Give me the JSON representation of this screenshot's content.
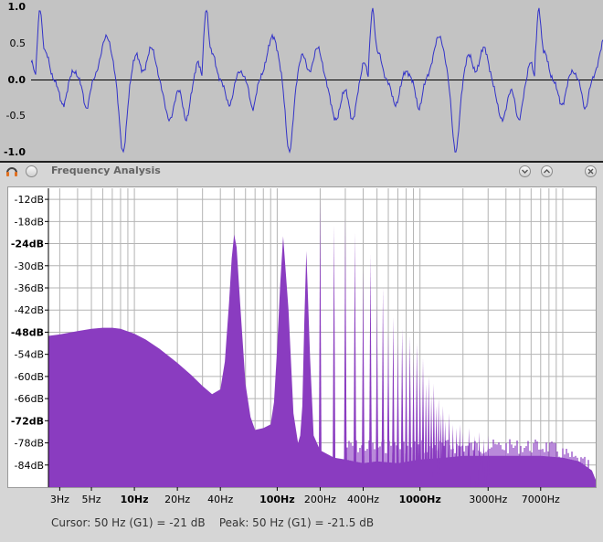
{
  "waveform": {
    "y_labels": [
      "1.0",
      "0.5",
      "0.0",
      "-0.5",
      "-1.0"
    ],
    "y_values": [
      1.0,
      0.5,
      0.0,
      -0.5,
      -1.0
    ],
    "bold_labels": [
      "1.0",
      "0.0",
      "-1.0"
    ],
    "line_color": "#3232c8",
    "zero_line_color": "#000000"
  },
  "window": {
    "title": "Frequency Analysis",
    "buttons": [
      "audio-icon",
      "menu-icon",
      "minimize-icon",
      "maximize-icon",
      "close-icon"
    ]
  },
  "chart_data": {
    "type": "area",
    "title": "",
    "xlabel": "",
    "ylabel": "",
    "x_scale": "log",
    "x_ticks": [
      {
        "label": "3Hz",
        "value": 3,
        "bold": false
      },
      {
        "label": "5Hz",
        "value": 5,
        "bold": false
      },
      {
        "label": "10Hz",
        "value": 10,
        "bold": true
      },
      {
        "label": "20Hz",
        "value": 20,
        "bold": false
      },
      {
        "label": "40Hz",
        "value": 40,
        "bold": false
      },
      {
        "label": "100Hz",
        "value": 100,
        "bold": true
      },
      {
        "label": "200Hz",
        "value": 200,
        "bold": false
      },
      {
        "label": "400Hz",
        "value": 400,
        "bold": false
      },
      {
        "label": "1000Hz",
        "value": 1000,
        "bold": true
      },
      {
        "label": "3000Hz",
        "value": 3000,
        "bold": false
      },
      {
        "label": "7000Hz",
        "value": 7000,
        "bold": false
      }
    ],
    "y_ticks": [
      {
        "label": "-12dB",
        "value": -12,
        "bold": false
      },
      {
        "label": "-18dB",
        "value": -18,
        "bold": false
      },
      {
        "label": "-24dB",
        "value": -24,
        "bold": true
      },
      {
        "label": "-30dB",
        "value": -30,
        "bold": false
      },
      {
        "label": "-36dB",
        "value": -36,
        "bold": false
      },
      {
        "label": "-42dB",
        "value": -42,
        "bold": false
      },
      {
        "label": "-48dB",
        "value": -48,
        "bold": true
      },
      {
        "label": "-54dB",
        "value": -54,
        "bold": false
      },
      {
        "label": "-60dB",
        "value": -60,
        "bold": false
      },
      {
        "label": "-66dB",
        "value": -66,
        "bold": false
      },
      {
        "label": "-72dB",
        "value": -72,
        "bold": true
      },
      {
        "label": "-78dB",
        "value": -78,
        "bold": false
      },
      {
        "label": "-84dB",
        "value": -84,
        "bold": false
      }
    ],
    "xlim": [
      2.5,
      17000
    ],
    "ylim": [
      -90,
      -9
    ],
    "grid": true,
    "fill_color": "#8a3cc0",
    "spectrum": {
      "x": [
        2.5,
        3,
        4,
        5,
        6,
        7,
        8,
        10,
        12,
        15,
        20,
        25,
        30,
        35,
        40,
        43,
        46,
        48,
        50,
        52,
        55,
        60,
        65,
        70,
        80,
        90,
        95,
        100,
        105,
        110,
        120,
        130,
        140,
        145,
        150,
        155,
        160,
        170,
        180,
        200,
        250,
        300,
        400,
        500,
        700,
        1000,
        1500,
        2000,
        3000,
        5000,
        7000,
        10000,
        13000,
        16000,
        17000
      ],
      "y": [
        -49,
        -48.6,
        -47.7,
        -47.1,
        -46.8,
        -46.8,
        -47.1,
        -48.4,
        -50,
        -52.5,
        -56.3,
        -59.6,
        -62.6,
        -64.8,
        -63.5,
        -56,
        -40,
        -28,
        -21.5,
        -25,
        -40,
        -62,
        -71,
        -74.5,
        -74,
        -73,
        -67,
        -52,
        -35,
        -22,
        -42,
        -70,
        -78,
        -76,
        -68,
        -45,
        -26,
        -55,
        -76,
        -80,
        -82,
        -82.5,
        -83.5,
        -83,
        -83.5,
        -82.5,
        -82,
        -81.5,
        -81.5,
        -81.5,
        -81.5,
        -82,
        -83,
        -85.5,
        -88
      ]
    },
    "harmonic_spikes": [
      {
        "f": 200,
        "db": -12
      },
      {
        "f": 250,
        "db": -19
      },
      {
        "f": 300,
        "db": -17
      },
      {
        "f": 350,
        "db": -21
      },
      {
        "f": 400,
        "db": -31
      },
      {
        "f": 450,
        "db": -27
      },
      {
        "f": 500,
        "db": -40
      },
      {
        "f": 550,
        "db": -36
      },
      {
        "f": 600,
        "db": -48
      },
      {
        "f": 650,
        "db": -44
      },
      {
        "f": 700,
        "db": -51
      },
      {
        "f": 750,
        "db": -47
      },
      {
        "f": 800,
        "db": -52
      },
      {
        "f": 850,
        "db": -49
      },
      {
        "f": 900,
        "db": -55
      },
      {
        "f": 950,
        "db": -51
      },
      {
        "f": 1000,
        "db": -58
      },
      {
        "f": 1050,
        "db": -55
      },
      {
        "f": 1100,
        "db": -62
      },
      {
        "f": 1150,
        "db": -60
      },
      {
        "f": 1200,
        "db": -65
      },
      {
        "f": 1250,
        "db": -62
      },
      {
        "f": 1300,
        "db": -68
      },
      {
        "f": 1350,
        "db": -66
      },
      {
        "f": 1400,
        "db": -70
      },
      {
        "f": 1450,
        "db": -68
      },
      {
        "f": 1500,
        "db": -72
      },
      {
        "f": 1600,
        "db": -70
      },
      {
        "f": 1700,
        "db": -73
      },
      {
        "f": 1800,
        "db": -74
      },
      {
        "f": 1900,
        "db": -73
      },
      {
        "f": 2000,
        "db": -75
      },
      {
        "f": 2200,
        "db": -74
      },
      {
        "f": 2400,
        "db": -76
      },
      {
        "f": 2600,
        "db": -75
      },
      {
        "f": 2800,
        "db": -77
      },
      {
        "f": 3000,
        "db": -76
      }
    ]
  },
  "status": {
    "cursor": "Cursor: 50 Hz (G1) = -21 dB",
    "peak": "Peak: 50 Hz (G1) = -21.5 dB"
  }
}
